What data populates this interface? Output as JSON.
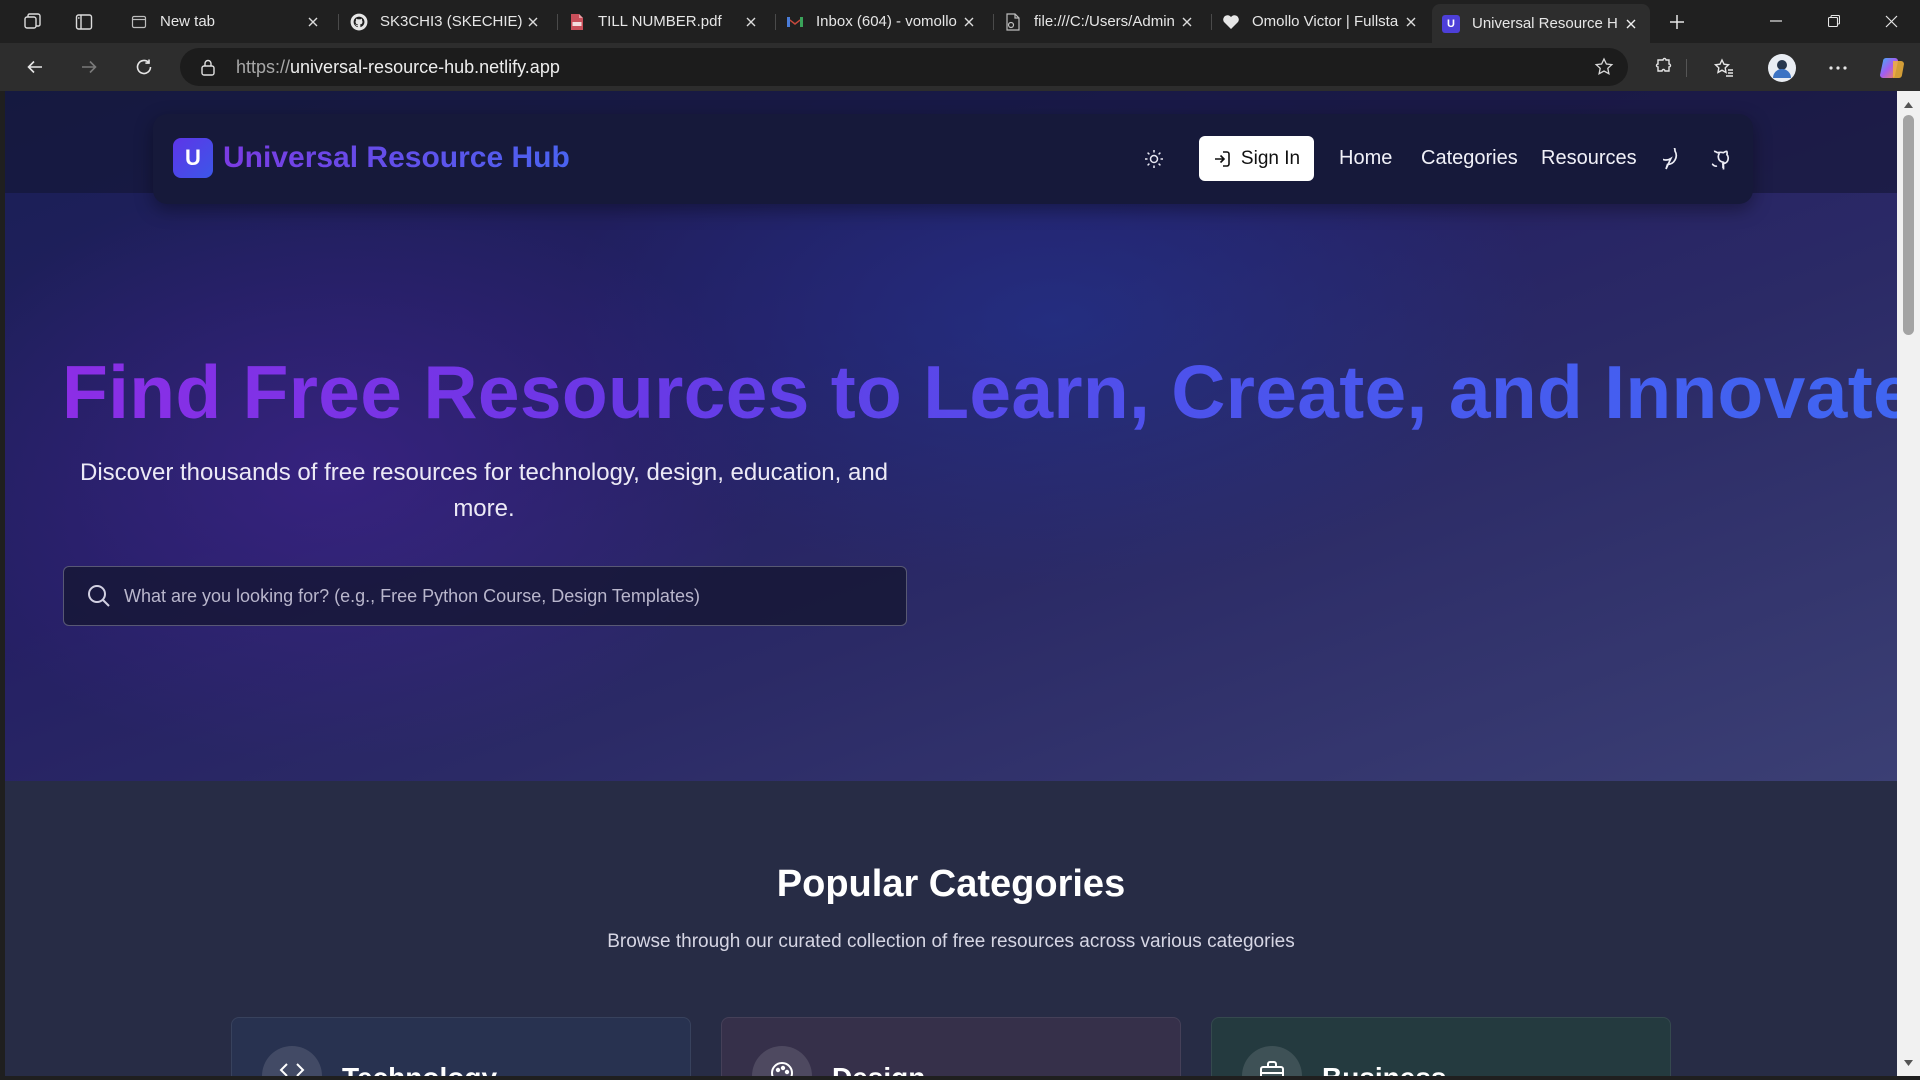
{
  "browser": {
    "tabs": [
      {
        "title": "New tab",
        "icon": "new-tab-page-icon"
      },
      {
        "title": "SK3CHI3 (SKECHIE)",
        "icon": "github-icon"
      },
      {
        "title": "TILL NUMBER.pdf",
        "icon": "pdf-icon"
      },
      {
        "title": "Inbox (604) - vomollo",
        "icon": "gmail-icon"
      },
      {
        "title": "file:///C:/Users/Admin",
        "icon": "file-icon"
      },
      {
        "title": "Omollo Victor | Fullsta",
        "icon": "heart-icon"
      },
      {
        "title": "Universal Resource H",
        "icon": "site-u-icon",
        "active": true
      }
    ],
    "url_protocol": "https://",
    "url_host": "universal-resource-hub.netlify.app"
  },
  "header": {
    "logo_letter": "U",
    "brand": "Universal Resource Hub",
    "sign_in": "Sign In",
    "nav_links": [
      "Home",
      "Categories",
      "Resources"
    ]
  },
  "hero": {
    "title": "Find Free Resources to Learn, Create, and Innovate",
    "subtitle": "Discover thousands of free resources for technology, design, education, and more.",
    "search_placeholder": "What are you looking for? (e.g., Free Python Course, Design Templates)"
  },
  "categories": {
    "title": "Popular Categories",
    "subtitle": "Browse through our curated collection of free resources across various categories",
    "cards": [
      {
        "name": "Technology",
        "icon": "code-icon",
        "color": "#283250"
      },
      {
        "name": "Design",
        "icon": "palette-icon",
        "color": "#36304a"
      },
      {
        "name": "Business",
        "icon": "briefcase-icon",
        "color": "#243a3f"
      }
    ]
  },
  "colors": {
    "accent_purple": "#7b3be3",
    "accent_blue": "#4a63f0",
    "nav_bg": "#16193a"
  }
}
